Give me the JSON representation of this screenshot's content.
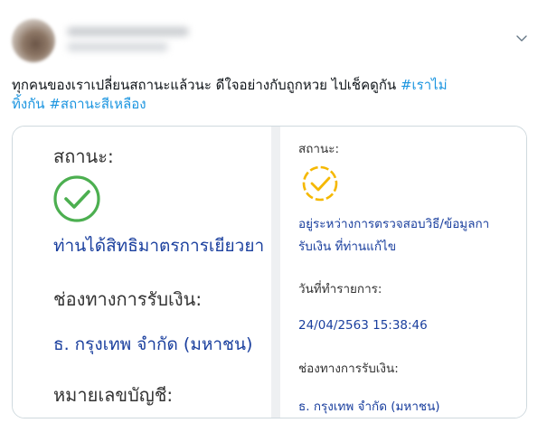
{
  "tweet": {
    "text_line1": "ทุกคนของเราเปลี่ยนสถานะแล้วนะ ดีใจอย่างกับถูกหวย ไปเช็คดูกัน ",
    "hashtag1": "#เราไม่ทิ้งกัน",
    "hashtag1_part1": "#เราไม่",
    "hashtag1_part2": "ทิ้งกัน",
    "hashtag2": "#สถานะสีเหลือง"
  },
  "left_panel": {
    "status_label": "สถานะ:",
    "status_icon": "check-circle-green",
    "status_text": "ท่านได้สิทธิมาตรการเยียวยา !",
    "channel_label": "ช่องทางการรับเงิน:",
    "channel_value": "ธ. กรุงเทพ จำกัด (มหาชน)",
    "account_label": "หมายเลขบัญชี:"
  },
  "right_panel": {
    "status_label": "สถานะ:",
    "status_icon": "check-circle-dashed-yellow",
    "status_text_line1": "อยู่ระหว่างการตรวจสอบวิธี/ข้อมูลกา",
    "status_text_line2": "รับเงิน ที่ท่านแก้ไข",
    "date_label": "วันที่ทำรายการ:",
    "date_value": "24/04/2563 15:38:46",
    "channel_label": "ช่องทางการรับเงิน:",
    "channel_value": "ธ. กรุงเทพ จำกัด (มหาชน)"
  },
  "colors": {
    "hashtag": "#1b95e0",
    "green_check": "#4caf50",
    "yellow_check": "#f5b800",
    "value_blue": "#1a3f9e"
  }
}
